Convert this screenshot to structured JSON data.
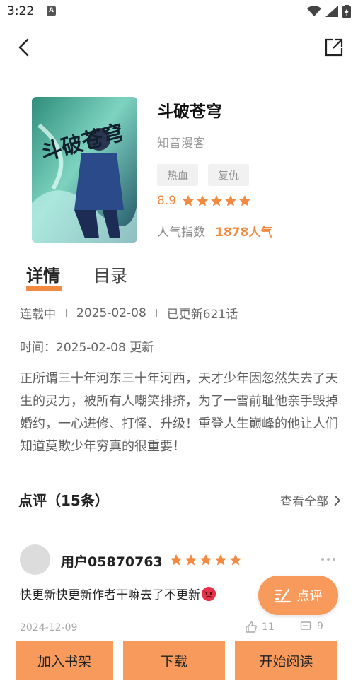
{
  "status_bar": {
    "time": "3:22",
    "indicator": "A",
    "icons": [
      "wifi-icon",
      "signal-icon",
      "battery-charging-icon"
    ]
  },
  "nav": {
    "back_icon": "chevron-left-icon",
    "share_icon": "share-icon"
  },
  "book": {
    "cover_title_art": "斗破苍穹",
    "title": "斗破苍穹",
    "author": "知音漫客",
    "tags": [
      "热血",
      "复仇"
    ],
    "rating": "8.9",
    "stars": 5,
    "popularity_label": "人气指数",
    "popularity_value": "1878人气"
  },
  "tabs": {
    "detail": "详情",
    "catalog": "目录"
  },
  "meta": {
    "status": "连载中",
    "date": "2025-02-08",
    "chapters": "已更新621话",
    "update_time": "时间：2025-02-08 更新"
  },
  "description": "正所谓三十年河东三十年河西，天才少年因忽然失去了天生的灵力，被所有人嘲笑排挤，为了一雪前耻他亲手毁掉婚约，一心进修、打怪、升级！重登人生巅峰的他让人们知道莫欺少年穷真的很重要！",
  "reviews": {
    "title": "点评（15条）",
    "view_all": "查看全部",
    "items": [
      {
        "user": "用户05870763",
        "stars": 5,
        "text": "快更新快更新作者干嘛去了不更新",
        "date": "2024-12-09",
        "likes": "11",
        "comments": "9"
      }
    ]
  },
  "fab": {
    "label": "点评"
  },
  "bottom_bar": {
    "add_shelf": "加入书架",
    "download": "下载",
    "start_reading": "开始阅读"
  },
  "colors": {
    "accent": "#f28a42",
    "button": "#f79a5b",
    "tag_bg": "#f1f1f1"
  }
}
